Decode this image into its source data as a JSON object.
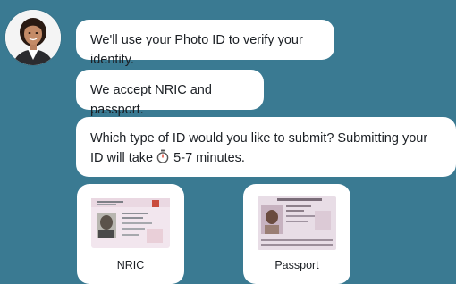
{
  "chat": {
    "msg1": "We'll use your Photo ID to verify your identity.",
    "msg2": "We accept NRIC and passport.",
    "msg3_before": "Which type of ID would you like to submit? Submitting your ID will take",
    "msg3_after": "5-7 minutes.",
    "timer_icon": "stopwatch-icon"
  },
  "options": [
    {
      "label": "NRIC",
      "icon": "nric-card-image"
    },
    {
      "label": "Passport",
      "icon": "passport-image"
    }
  ],
  "colors": {
    "background": "#3a7a92",
    "bubble": "#ffffff",
    "text": "#1b1f24"
  }
}
